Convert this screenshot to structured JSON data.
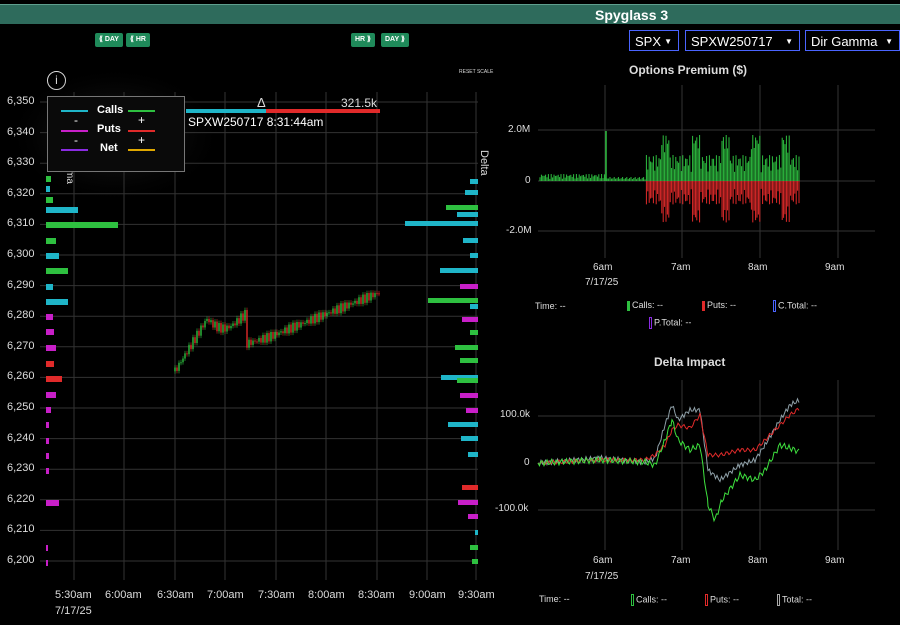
{
  "app": {
    "title": "Spyglass 3"
  },
  "left_buttons": {
    "day_back": "⟪ DAY",
    "hr_back": "⟪ HR",
    "hr_fwd": "HR ⟫",
    "day_fwd": "DAY ⟫"
  },
  "selectors": {
    "symbol": "SPX",
    "expiry": "SPXW250717",
    "mode": "Dir Gamma"
  },
  "main_chart": {
    "reset_label": "RESET SCALE",
    "delta_symbol": "Δ",
    "delta_value": "321.5k",
    "tooltip": "SPXW250717 8:31:44am",
    "side_label": "Delta",
    "partial_label": "ma",
    "y_ticks": [
      "6,350",
      "6,340",
      "6,330",
      "6,320",
      "6,310",
      "6,300",
      "6,290",
      "6,280",
      "6,270",
      "6,260",
      "6,250",
      "6,240",
      "6,230",
      "6,220",
      "6,210",
      "6,200"
    ],
    "x_ticks": [
      "5:30am",
      "6:00am",
      "6:30am",
      "7:00am",
      "7:30am",
      "8:00am",
      "8:30am",
      "9:00am",
      "9:30am"
    ],
    "date": "7/17/25",
    "legend": {
      "calls": "Calls",
      "puts": "Puts",
      "net": "Net",
      "minus": "-",
      "plus": "+"
    }
  },
  "premium_chart": {
    "title": "Options Premium ($)",
    "y_ticks": [
      "2.0M",
      "0",
      "-2.0M"
    ],
    "x_ticks": [
      "6am",
      "7am",
      "8am",
      "9am"
    ],
    "date": "7/17/25",
    "stats": {
      "time": "Time:",
      "time_val": "--",
      "calls": "Calls:",
      "calls_val": "--",
      "puts": "Puts:",
      "puts_val": "--",
      "ctotal": "C.Total:",
      "ctotal_val": "--",
      "ptotal": "P.Total:",
      "ptotal_val": "--"
    }
  },
  "delta_chart": {
    "title": "Delta Impact",
    "y_ticks": [
      "100.0k",
      "0",
      "-100.0k"
    ],
    "x_ticks": [
      "6am",
      "7am",
      "8am",
      "9am"
    ],
    "date": "7/17/25",
    "stats": {
      "time": "Time:",
      "time_val": "--",
      "calls": "Calls:",
      "calls_val": "--",
      "puts": "Puts:",
      "puts_val": "--",
      "total": "Total:",
      "total_val": "--"
    }
  },
  "colors": {
    "calls": "#2ec040",
    "puts": "#e02a2a",
    "cyan": "#1fb5c8",
    "magenta": "#c81fc8",
    "net": "#8a2be2",
    "net_pos": "#e0a800",
    "header": "#2e6b5c"
  }
}
